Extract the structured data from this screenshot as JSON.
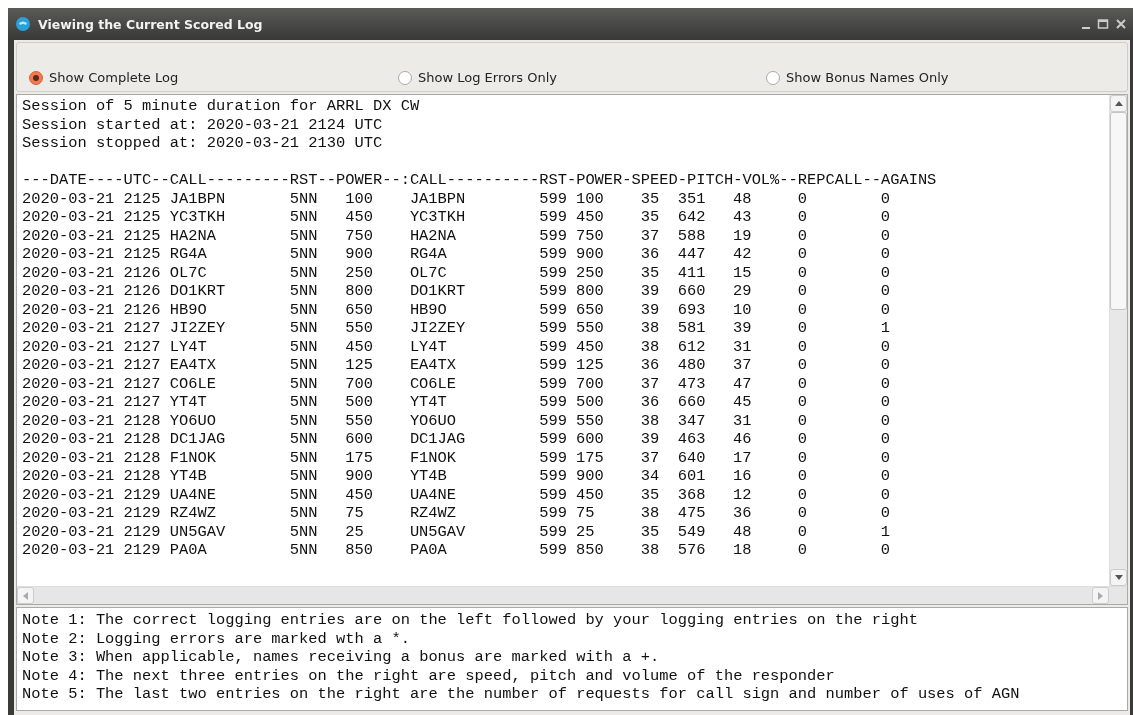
{
  "window": {
    "title": "Viewing the Current Scored Log"
  },
  "view_options": [
    {
      "label": "Show Complete Log",
      "selected": true
    },
    {
      "label": "Show Log Errors Only",
      "selected": false
    },
    {
      "label": "Show Bonus Names Only",
      "selected": false
    }
  ],
  "log": {
    "session_lines": [
      "Session of 5 minute duration for ARRL DX CW",
      "Session started at: 2020-03-21 2124 UTC",
      "Session stopped at: 2020-03-21 2130 UTC"
    ],
    "column_header": "---DATE----UTC--CALL---------RST--POWER--:CALL----------RST-POWER-SPEED-PITCH-VOL%--REPCALL--AGAINS",
    "rows": [
      [
        "2020-03-21",
        "2125",
        "JA1BPN",
        "5NN",
        "100",
        "JA1BPN",
        "599",
        "100",
        "35",
        "351",
        "48",
        "0",
        "0"
      ],
      [
        "2020-03-21",
        "2125",
        "YC3TKH",
        "5NN",
        "450",
        "YC3TKH",
        "599",
        "450",
        "35",
        "642",
        "43",
        "0",
        "0"
      ],
      [
        "2020-03-21",
        "2125",
        "HA2NA",
        "5NN",
        "750",
        "HA2NA",
        "599",
        "750",
        "37",
        "588",
        "19",
        "0",
        "0"
      ],
      [
        "2020-03-21",
        "2125",
        "RG4A",
        "5NN",
        "900",
        "RG4A",
        "599",
        "900",
        "36",
        "447",
        "42",
        "0",
        "0"
      ],
      [
        "2020-03-21",
        "2126",
        "OL7C",
        "5NN",
        "250",
        "OL7C",
        "599",
        "250",
        "35",
        "411",
        "15",
        "0",
        "0"
      ],
      [
        "2020-03-21",
        "2126",
        "DO1KRT",
        "5NN",
        "800",
        "DO1KRT",
        "599",
        "800",
        "39",
        "660",
        "29",
        "0",
        "0"
      ],
      [
        "2020-03-21",
        "2126",
        "HB9O",
        "5NN",
        "650",
        "HB9O",
        "599",
        "650",
        "39",
        "693",
        "10",
        "0",
        "0"
      ],
      [
        "2020-03-21",
        "2127",
        "JI2ZEY",
        "5NN",
        "550",
        "JI2ZEY",
        "599",
        "550",
        "38",
        "581",
        "39",
        "0",
        "1"
      ],
      [
        "2020-03-21",
        "2127",
        "LY4T",
        "5NN",
        "450",
        "LY4T",
        "599",
        "450",
        "38",
        "612",
        "31",
        "0",
        "0"
      ],
      [
        "2020-03-21",
        "2127",
        "EA4TX",
        "5NN",
        "125",
        "EA4TX",
        "599",
        "125",
        "36",
        "480",
        "37",
        "0",
        "0"
      ],
      [
        "2020-03-21",
        "2127",
        "CO6LE",
        "5NN",
        "700",
        "CO6LE",
        "599",
        "700",
        "37",
        "473",
        "47",
        "0",
        "0"
      ],
      [
        "2020-03-21",
        "2127",
        "YT4T",
        "5NN",
        "500",
        "YT4T",
        "599",
        "500",
        "36",
        "660",
        "45",
        "0",
        "0"
      ],
      [
        "2020-03-21",
        "2128",
        "YO6UO",
        "5NN",
        "550",
        "YO6UO",
        "599",
        "550",
        "38",
        "347",
        "31",
        "0",
        "0"
      ],
      [
        "2020-03-21",
        "2128",
        "DC1JAG",
        "5NN",
        "600",
        "DC1JAG",
        "599",
        "600",
        "39",
        "463",
        "46",
        "0",
        "0"
      ],
      [
        "2020-03-21",
        "2128",
        "F1NOK",
        "5NN",
        "175",
        "F1NOK",
        "599",
        "175",
        "37",
        "640",
        "17",
        "0",
        "0"
      ],
      [
        "2020-03-21",
        "2128",
        "YT4B",
        "5NN",
        "900",
        "YT4B",
        "599",
        "900",
        "34",
        "601",
        "16",
        "0",
        "0"
      ],
      [
        "2020-03-21",
        "2129",
        "UA4NE",
        "5NN",
        "450",
        "UA4NE",
        "599",
        "450",
        "35",
        "368",
        "12",
        "0",
        "0"
      ],
      [
        "2020-03-21",
        "2129",
        "RZ4WZ",
        "5NN",
        "75",
        "RZ4WZ",
        "599",
        "75",
        "38",
        "475",
        "36",
        "0",
        "0"
      ],
      [
        "2020-03-21",
        "2129",
        "UN5GAV",
        "5NN",
        "25",
        "UN5GAV",
        "599",
        "25",
        "35",
        "549",
        "48",
        "0",
        "1"
      ],
      [
        "2020-03-21",
        "2129",
        "PA0A",
        "5NN",
        "850",
        "PA0A",
        "599",
        "850",
        "38",
        "576",
        "18",
        "0",
        "0"
      ]
    ]
  },
  "notes": [
    "Note 1: The correct logging entries are on the left followed by your logging entries on the right",
    "Note 2: Logging errors are marked wth a *.",
    "Note 3: When applicable, names receiving a bonus are marked with a +.",
    "Note 4: The next three entries on the right are speed, pitch and volume of the responder",
    "Note 5: The last two entries on the right are the number of requests for call sign and number of uses of AGN"
  ]
}
